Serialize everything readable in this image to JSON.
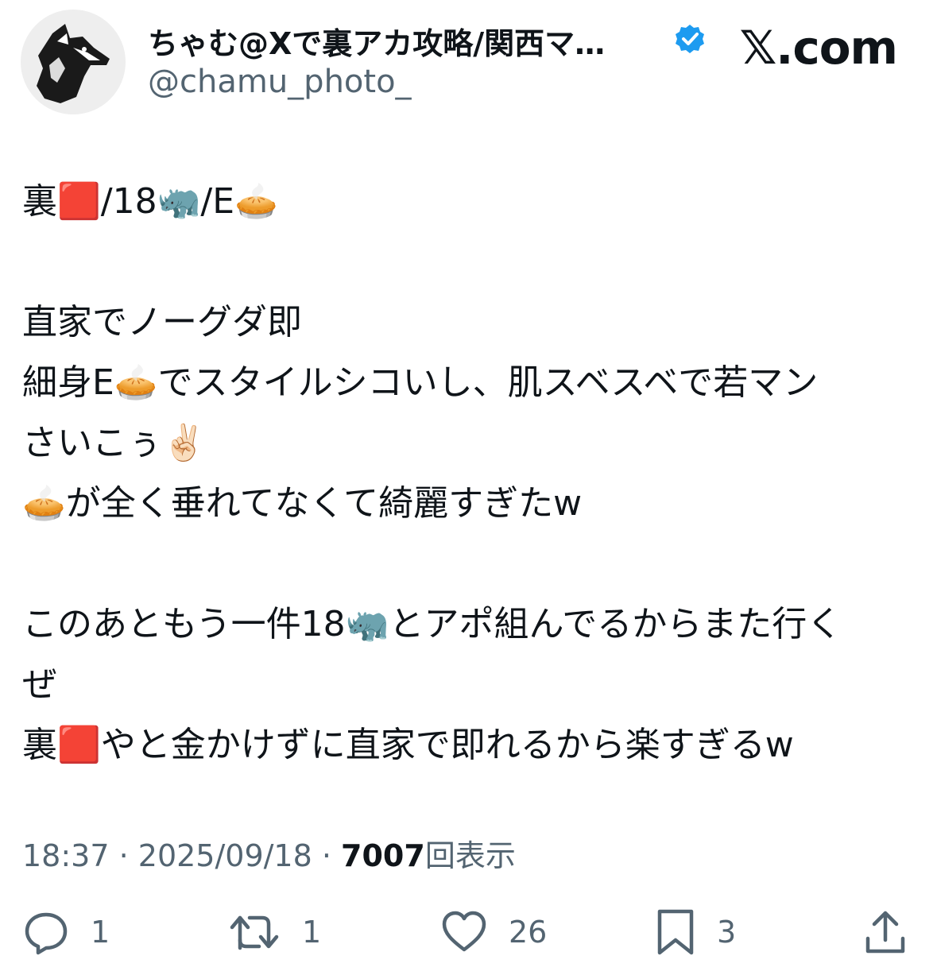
{
  "header": {
    "display_name": "ちゃむ@Xで裏アカ攻略/関西マ…",
    "handle": "@chamu_photo_",
    "brand": "𝕏.com",
    "verified_color": "#1d9bf0",
    "avatar_icon": "wolf-avatar"
  },
  "tweet": {
    "lines": [
      "裏🟥/18🦏/E🥧",
      "",
      "直家でノーグダ即",
      "細身E🥧でスタイルシコいし、肌スベスベで若マン",
      "さいこぅ✌🏻",
      "🥧が全く垂れてなくて綺麗すぎたw",
      "",
      "このあともう一件18🦏とアポ組んでるからまた行く",
      "ぜ",
      "裏🟥やと金かけずに直家で即れるから楽すぎるw"
    ]
  },
  "meta": {
    "time": "18:37",
    "sep": " · ",
    "date": "2025/09/18",
    "views_count": "7007",
    "views_label": "回表示"
  },
  "actions": {
    "reply_count": "1",
    "repost_count": "1",
    "like_count": "26",
    "bookmark_count": "3"
  }
}
